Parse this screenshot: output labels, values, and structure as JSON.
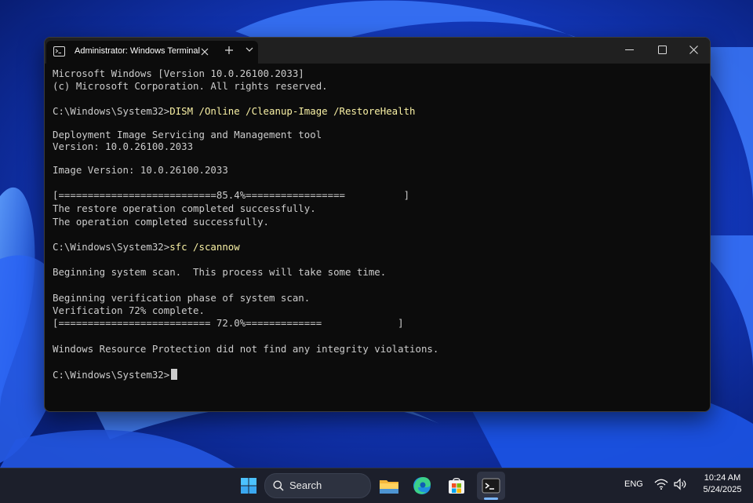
{
  "window": {
    "tab_title": "Administrator: Windows Terminal"
  },
  "terminal": {
    "lines": [
      {
        "text": "Microsoft Windows [Version 10.0.26100.2033]"
      },
      {
        "text": "(c) Microsoft Corporation. All rights reserved."
      },
      {
        "prompt": "C:\\Windows\\System32>",
        "command": "DISM /Online /Cleanup-Image /RestoreHealth"
      },
      {
        "text": "Deployment Image Servicing and Management tool"
      },
      {
        "text": "Version: 10.0.26100.2033"
      },
      {
        "text": "Image Version: 10.0.26100.2033"
      },
      {
        "text": "[===========================85.4%=================          ]"
      },
      {
        "text": "The restore operation completed successfully."
      },
      {
        "text": "The operation completed successfully."
      },
      {
        "prompt": "C:\\Windows\\System32>",
        "command": "sfc /scannow"
      },
      {
        "text": "Beginning system scan.  This process will take some time."
      },
      {
        "text": "Beginning verification phase of system scan."
      },
      {
        "text": "Verification 72% complete."
      },
      {
        "text": "[========================== 72.0%=============             ]"
      },
      {
        "text": "Windows Resource Protection did not find any integrity violations."
      },
      {
        "prompt": "C:\\Windows\\System32>",
        "command": ""
      }
    ]
  },
  "taskbar": {
    "search_label": "Search",
    "language": "ENG",
    "time": "10:24 AM",
    "date": "5/24/2025",
    "icons": [
      "windows-start-icon",
      "search-icon",
      "file-explorer-icon",
      "edge-icon",
      "store-icon",
      "terminal-icon",
      "wifi-icon",
      "volume-icon"
    ]
  },
  "colors": {
    "terminal_bg": "#0c0c0c",
    "terminal_text": "#cccccc",
    "command_text": "#f9f1a5",
    "taskbar_bg": "#1c1f2b"
  }
}
